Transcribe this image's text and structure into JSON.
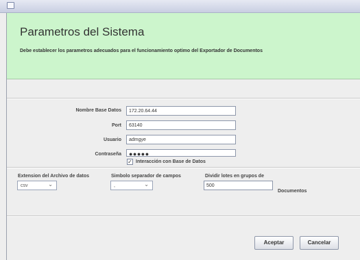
{
  "header": {
    "title": "Parametros del Sistema",
    "subtitle": "Debe establecer los parametros adecuados para el funcionamiento optimo del Exportador de Documentos"
  },
  "connection": {
    "db_name_label": "Nombre Base Datos",
    "db_name_value": "172.20.64.44",
    "port_label": "Port",
    "port_value": "63140",
    "user_label": "Usuario",
    "user_value": "admgye",
    "password_label": "Contraseña",
    "password_value": "●●●●●",
    "db_interaction_label": "Interacción con Base de Datos",
    "db_interaction_checked": true
  },
  "export": {
    "extension_label": "Extension del Archivo de datos",
    "extension_value": "csv",
    "separator_label": "Simbolo separador de campos",
    "separator_value": ",",
    "lots_label": "Dividir lotes en grupos de",
    "lots_value": "500",
    "lots_unit": "Documentos"
  },
  "actions": {
    "accept_label": "Aceptar",
    "cancel_label": "Cancelar"
  }
}
